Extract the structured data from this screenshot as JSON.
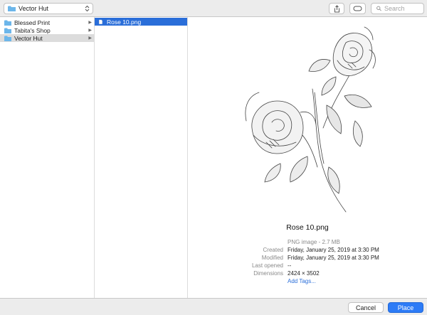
{
  "toolbar": {
    "location": "Vector Hut",
    "search_placeholder": "Search",
    "share_icon": "share-icon",
    "tag_icon": "tag-icon"
  },
  "sidebar": {
    "items": [
      {
        "label": "Blessed Print",
        "state": "normal"
      },
      {
        "label": "Tabita's Shop",
        "state": "normal"
      },
      {
        "label": "Vector Hut",
        "state": "selected-inactive"
      }
    ]
  },
  "files": {
    "items": [
      {
        "label": "Rose 10.png",
        "state": "selected"
      }
    ]
  },
  "preview": {
    "title": "Rose 10.png",
    "kind": "PNG image - 2.7 MB",
    "created_label": "Created",
    "created": "Friday, January 25, 2019 at 3:30 PM",
    "modified_label": "Modified",
    "modified": "Friday, January 25, 2019 at 3:30 PM",
    "last_opened_label": "Last opened",
    "last_opened": "--",
    "dimensions_label": "Dimensions",
    "dimensions": "2424 × 3502",
    "add_tags": "Add Tags..."
  },
  "buttons": {
    "cancel": "Cancel",
    "place": "Place"
  },
  "colors": {
    "accent": "#2a6ed9",
    "folder": "#6cb6ea"
  }
}
